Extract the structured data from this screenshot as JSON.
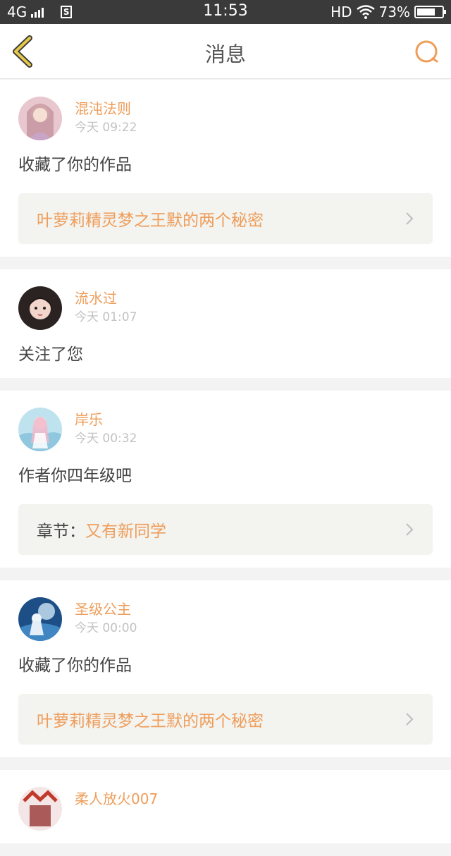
{
  "status_bar": {
    "network": "4G",
    "sim_label": "S",
    "time": "11:53",
    "hd": "HD",
    "battery": "73%",
    "battery_level": 0.73
  },
  "header": {
    "title": "消息",
    "back_icon": "chevron-left-icon",
    "search_icon": "search-icon",
    "accent_color": "#ef9d5a",
    "back_color": "#e5c84a"
  },
  "messages": [
    {
      "username": "混沌法则",
      "time": "今天 09:22",
      "action": "收藏了你的作品",
      "ref_label": "",
      "ref_value": "叶萝莉精灵梦之王默的两个秘密"
    },
    {
      "username": "流水过",
      "time": "今天 01:07",
      "action": "关注了您"
    },
    {
      "username": "岸乐",
      "time": "今天 00:32",
      "action": "作者你四年级吧",
      "ref_label": "章节：",
      "ref_value": "又有新同学"
    },
    {
      "username": "圣级公主",
      "time": "今天 00:00",
      "action": "收藏了你的作品",
      "ref_label": "",
      "ref_value": "叶萝莉精灵梦之王默的两个秘密"
    },
    {
      "username": "柔人放火007"
    }
  ]
}
